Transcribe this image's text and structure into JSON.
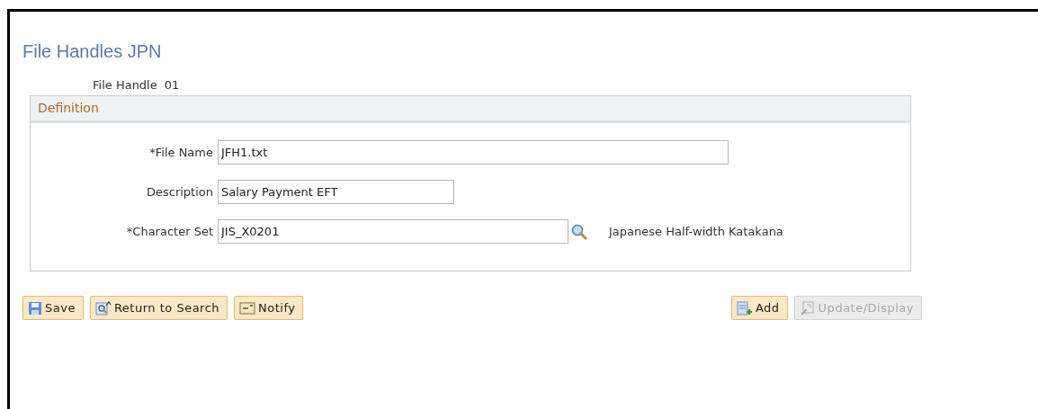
{
  "page_title": "File Handles JPN",
  "file_handle": {
    "label": "File Handle",
    "value": "01"
  },
  "definition": {
    "title": "Definition",
    "fields": [
      {
        "kind": "text",
        "label": "*File Name",
        "value": "JFH1.txt"
      },
      {
        "kind": "text",
        "label": "Description",
        "value": "Salary Payment EFT"
      },
      {
        "kind": "lookup",
        "label": "*Character Set",
        "value": "JIS_X0201",
        "note": "Japanese Half-width Katakana"
      }
    ]
  },
  "left_buttons": [
    {
      "kind": "save",
      "label": "Save",
      "disabled": false
    },
    {
      "kind": "return",
      "label": "Return to Search",
      "disabled": false
    },
    {
      "kind": "notify",
      "label": "Notify",
      "disabled": false
    }
  ],
  "right_buttons": [
    {
      "kind": "add",
      "label": "Add",
      "disabled": false
    },
    {
      "kind": "update",
      "label": "Update/Display",
      "disabled": true
    }
  ]
}
